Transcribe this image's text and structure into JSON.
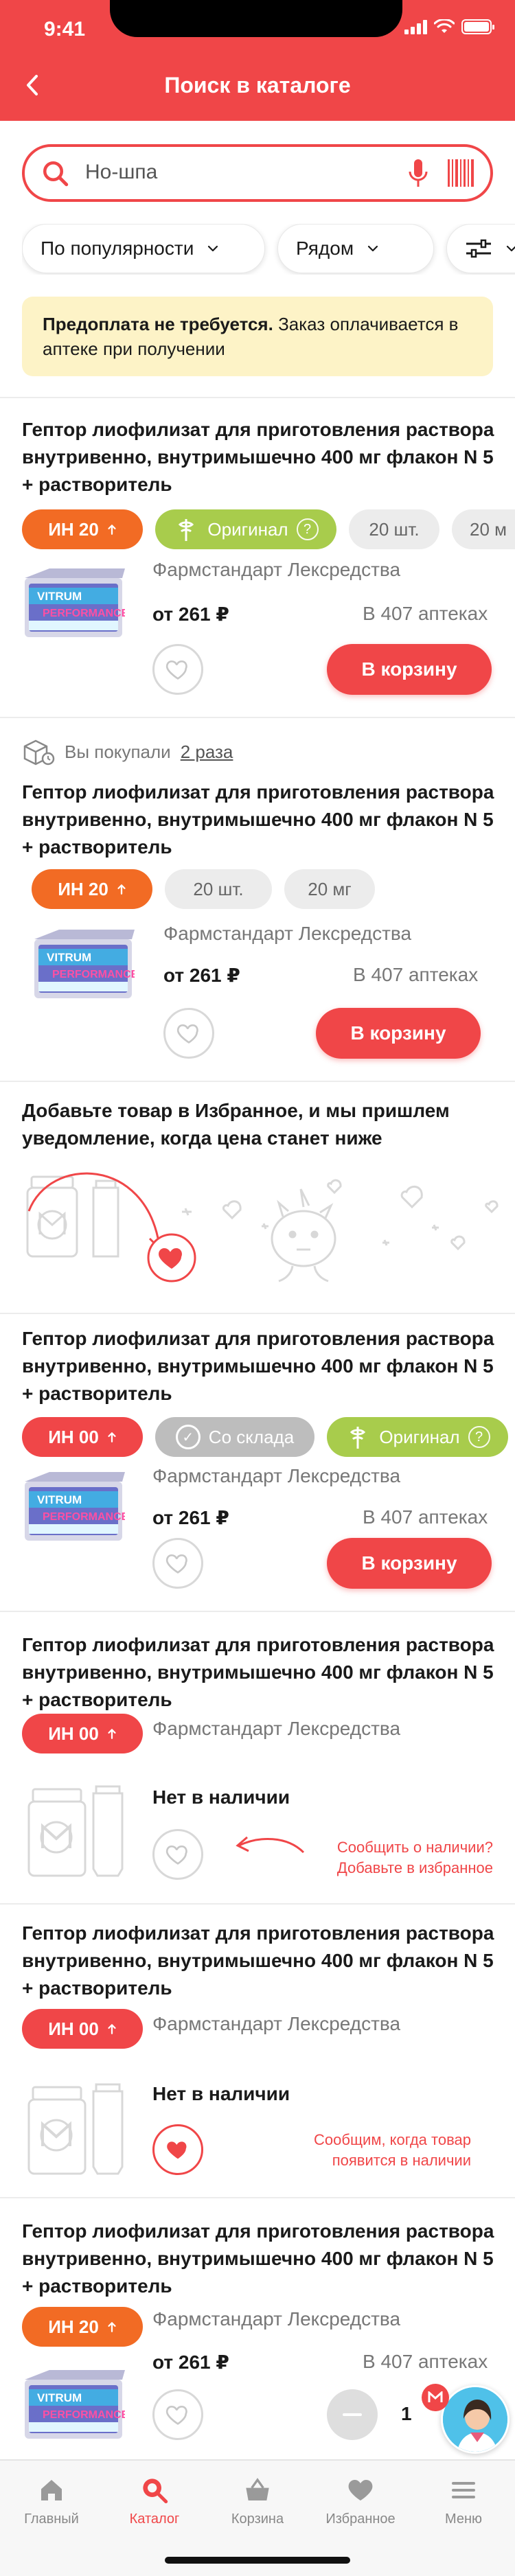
{
  "status": {
    "time": "9:41"
  },
  "header": {
    "title": "Поиск в каталоге"
  },
  "search": {
    "value": "Но-шпа"
  },
  "filters": {
    "sort": "По популярности",
    "distance": "Рядом"
  },
  "notice": {
    "bold": "Предоплата не требуется.",
    "text": " Заказ оплачивается в аптеке при получении"
  },
  "product_title": "Гептор лиофилизат для приготовления раствора внутривенно, внутримышечно 400 мг флакон N 5 + растворитель",
  "maker": "Фармстандарт Лексредства",
  "price": "от 261 ₽",
  "availability": "В 407 аптеках",
  "cart_label": "В корзину",
  "badges": {
    "in20": "ИН 20",
    "in00": "ИН 00",
    "original": "Оригинал",
    "count": "20 шт.",
    "dose": "20 мг",
    "dose_cut": "20 м",
    "warehouse": "Со склада"
  },
  "bought": {
    "prefix": "Вы покупали",
    "link": "2 раза"
  },
  "promo": {
    "title": "Добавьте товар в Избранное, и мы пришлем уведомление, когда цена станет ниже"
  },
  "oos": "Нет в наличии",
  "hints": {
    "notify_line1": "Сообщить о наличии?",
    "notify_line2": "Добавьте в избранное",
    "will_notify_line1": "Сообщим, когда товар",
    "will_notify_line2": "появится в наличии"
  },
  "cart_qty": "1",
  "tabs": [
    {
      "label": "Главный"
    },
    {
      "label": "Каталог"
    },
    {
      "label": "Корзина"
    },
    {
      "label": "Избранное"
    },
    {
      "label": "Меню"
    }
  ],
  "colors": {
    "accent": "#f04648",
    "orange": "#f26b24",
    "green": "#a8cc4c",
    "notice_bg": "#fdf3c7"
  }
}
